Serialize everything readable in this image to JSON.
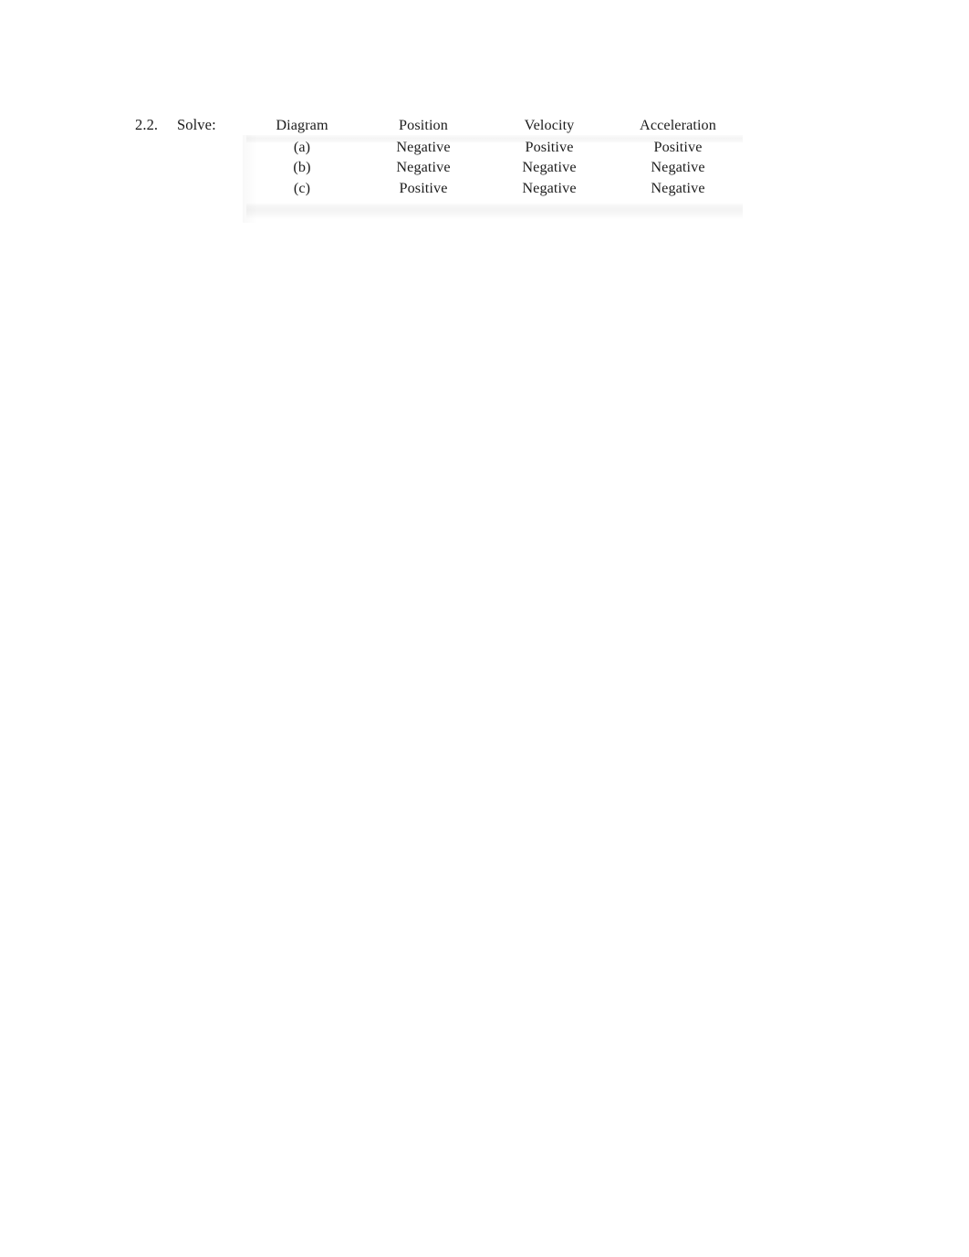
{
  "page": {
    "background_color": "#ffffff",
    "text_color": "#1a1a1a"
  },
  "problem": {
    "number": "2.2.",
    "verb": "Solve:"
  },
  "table": {
    "headers": [
      "Diagram",
      "Position",
      "Velocity",
      "Acceleration"
    ],
    "rows": [
      {
        "diagram": "(a)",
        "position": "Negative",
        "velocity": "Positive",
        "acceleration": "Positive"
      },
      {
        "diagram": "(b)",
        "position": "Negative",
        "velocity": "Negative",
        "acceleration": "Negative"
      },
      {
        "diagram": "(c)",
        "position": "Positive",
        "velocity": "Negative",
        "acceleration": "Negative"
      }
    ],
    "rule_color": "#ececec"
  }
}
